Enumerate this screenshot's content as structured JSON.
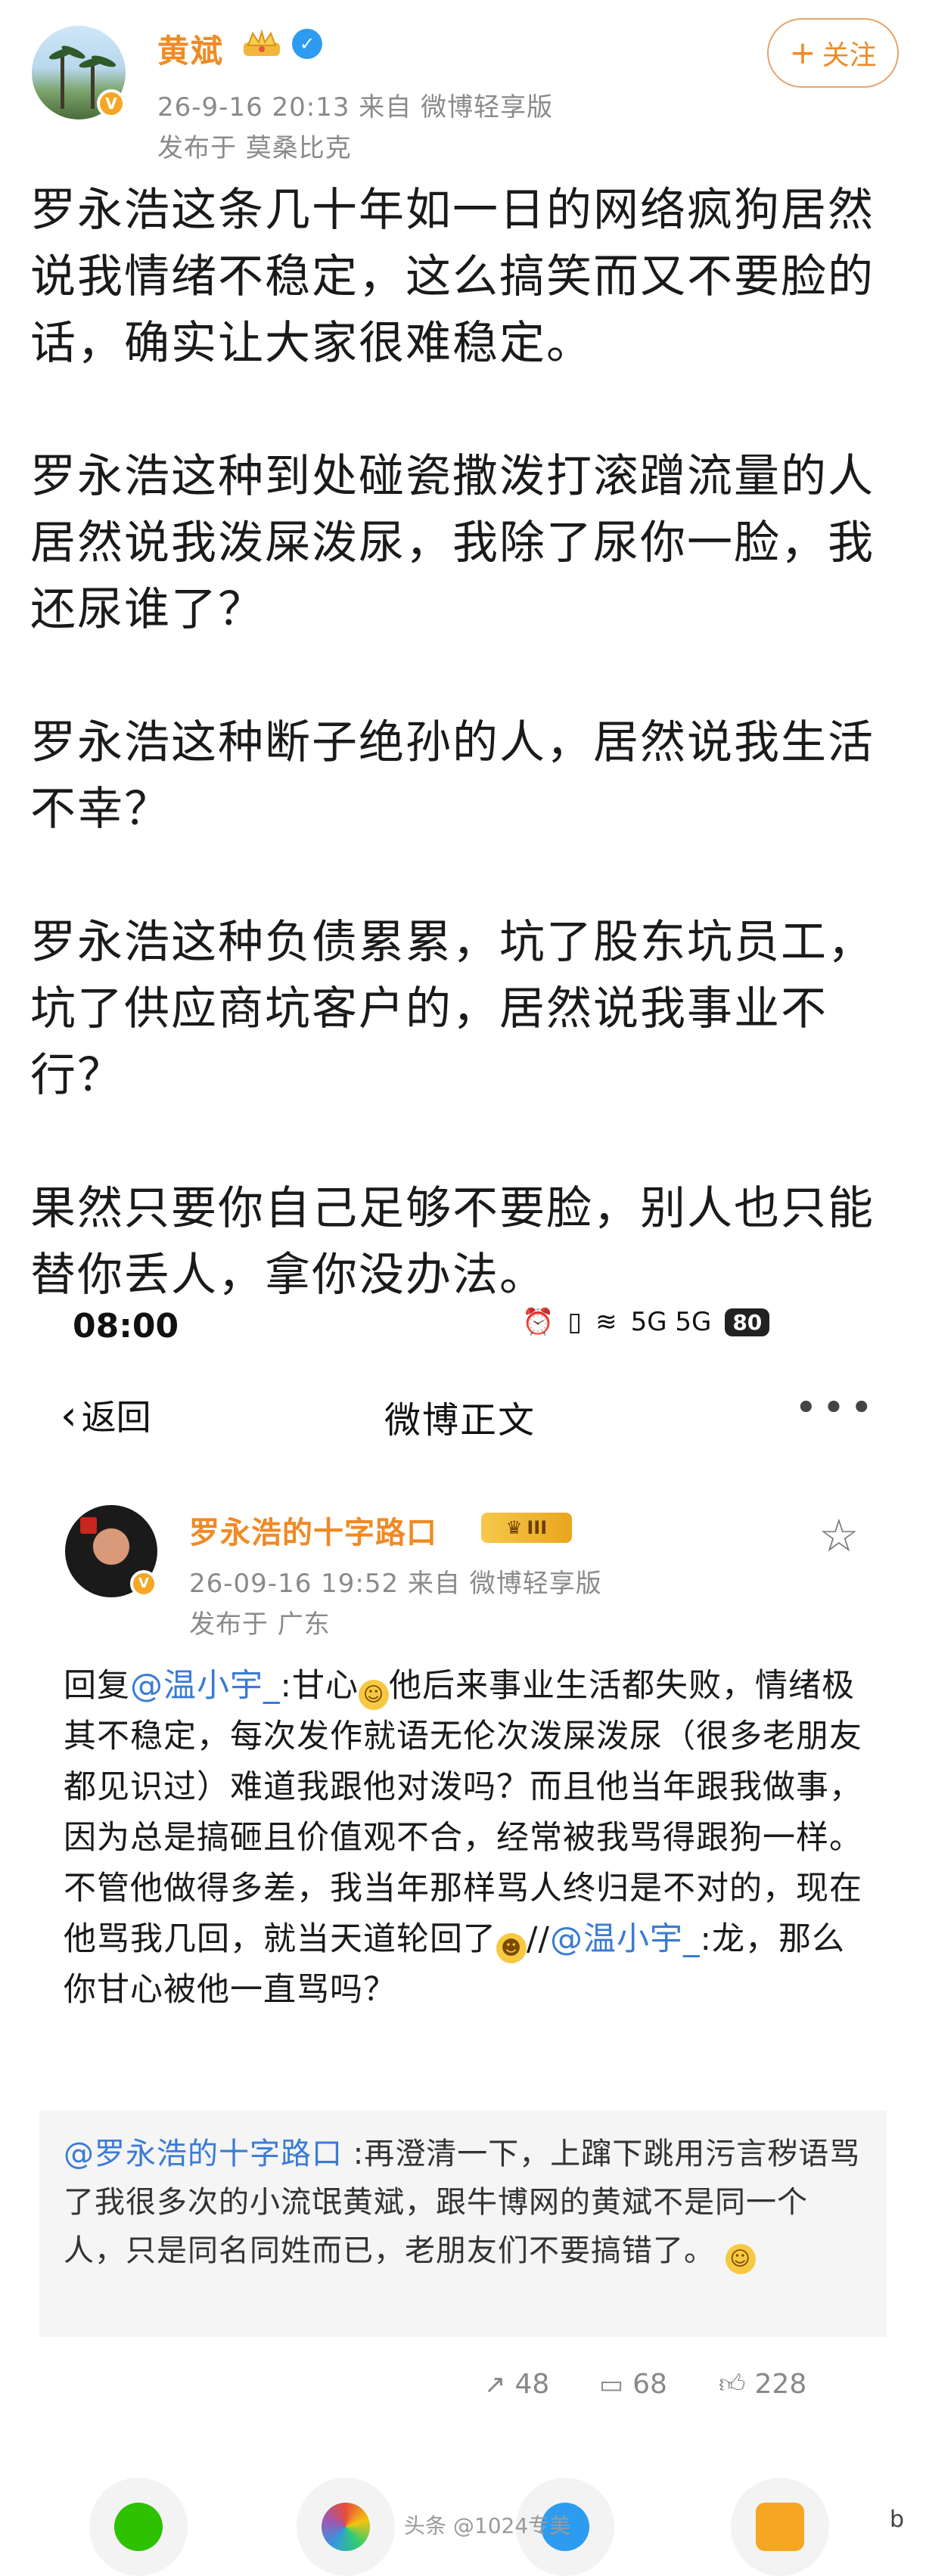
{
  "post": {
    "author": "黄斌",
    "meta": "26-9-16 20:13  来自 微博轻享版",
    "location": "发布于 莫桑比克",
    "follow_label": "关注",
    "paragraphs": [
      "罗永浩这条几十年如一日的网络疯狗居然说我情绪不稳定，这么搞笑而又不要脸的话，确实让大家很难稳定。",
      "罗永浩这种到处碰瓷撒泼打滚蹭流量的人居然说我泼屎泼尿，我除了尿你一脸，我还尿谁了？",
      "罗永浩这种断子绝孙的人，居然说我生活不幸？",
      "罗永浩这种负债累累，坑了股东坑员工，坑了供应商坑客户的，居然说我事业不行？",
      "果然只要你自己足够不要脸，别人也只能替你丢人，拿你没办法。"
    ]
  },
  "screenshot": {
    "status_time": "08:00",
    "status_network": "5G 5G",
    "battery": "80",
    "back_label": "返回",
    "nav_title": "微博正文",
    "reply_author": "罗永浩的十字路口",
    "level_badge": "III",
    "reply_meta": "26-09-16 19:52  来自 微博轻享版",
    "reply_location": "发布于 广东",
    "reply_prefix": "回复",
    "mention1": "@温小宇_",
    "reply_part1": ":甘心",
    "reply_part2": "他后来事业生活都失败，情绪极其不稳定，每次发作就语无伦次泼屎泼尿（很多老朋友都见识过）难道我跟他对泼吗？而且他当年跟我做事，因为总是搞砸且价值观不合，经常被我骂得跟狗一样。不管他做得多差，我当年那样骂人终归是不对的，现在他骂我几回，就当天道轮回了",
    "reply_sep": "//",
    "mention2": "@温小宇_",
    "reply_part3": ":龙，那么你甘心被他一直骂吗？",
    "quote_mention": "@罗永浩的十字路口",
    "quote_text": " :再澄清一下，上蹿下跳用污言秽语骂了我很多次的小流氓黄斌，跟牛博网的黄斌不是同一个人，只是同名同姓而已，老朋友们不要搞错了。",
    "reposts": "48",
    "comments": "68",
    "likes": "228"
  },
  "footer": {
    "watermark": "头条 @1024专美",
    "corner": "b"
  },
  "colors": {
    "brand_orange": "#f08a24",
    "link_blue": "#3a7bd5",
    "muted": "#8a8a8a"
  },
  "icons": [
    "crown-icon",
    "verified-icon",
    "plus-icon",
    "back-chevron-icon",
    "more-icon",
    "star-icon",
    "repost-icon",
    "comment-icon",
    "like-icon",
    "wechat-icon",
    "moments-icon",
    "weibo-icon",
    "qq-icon"
  ]
}
